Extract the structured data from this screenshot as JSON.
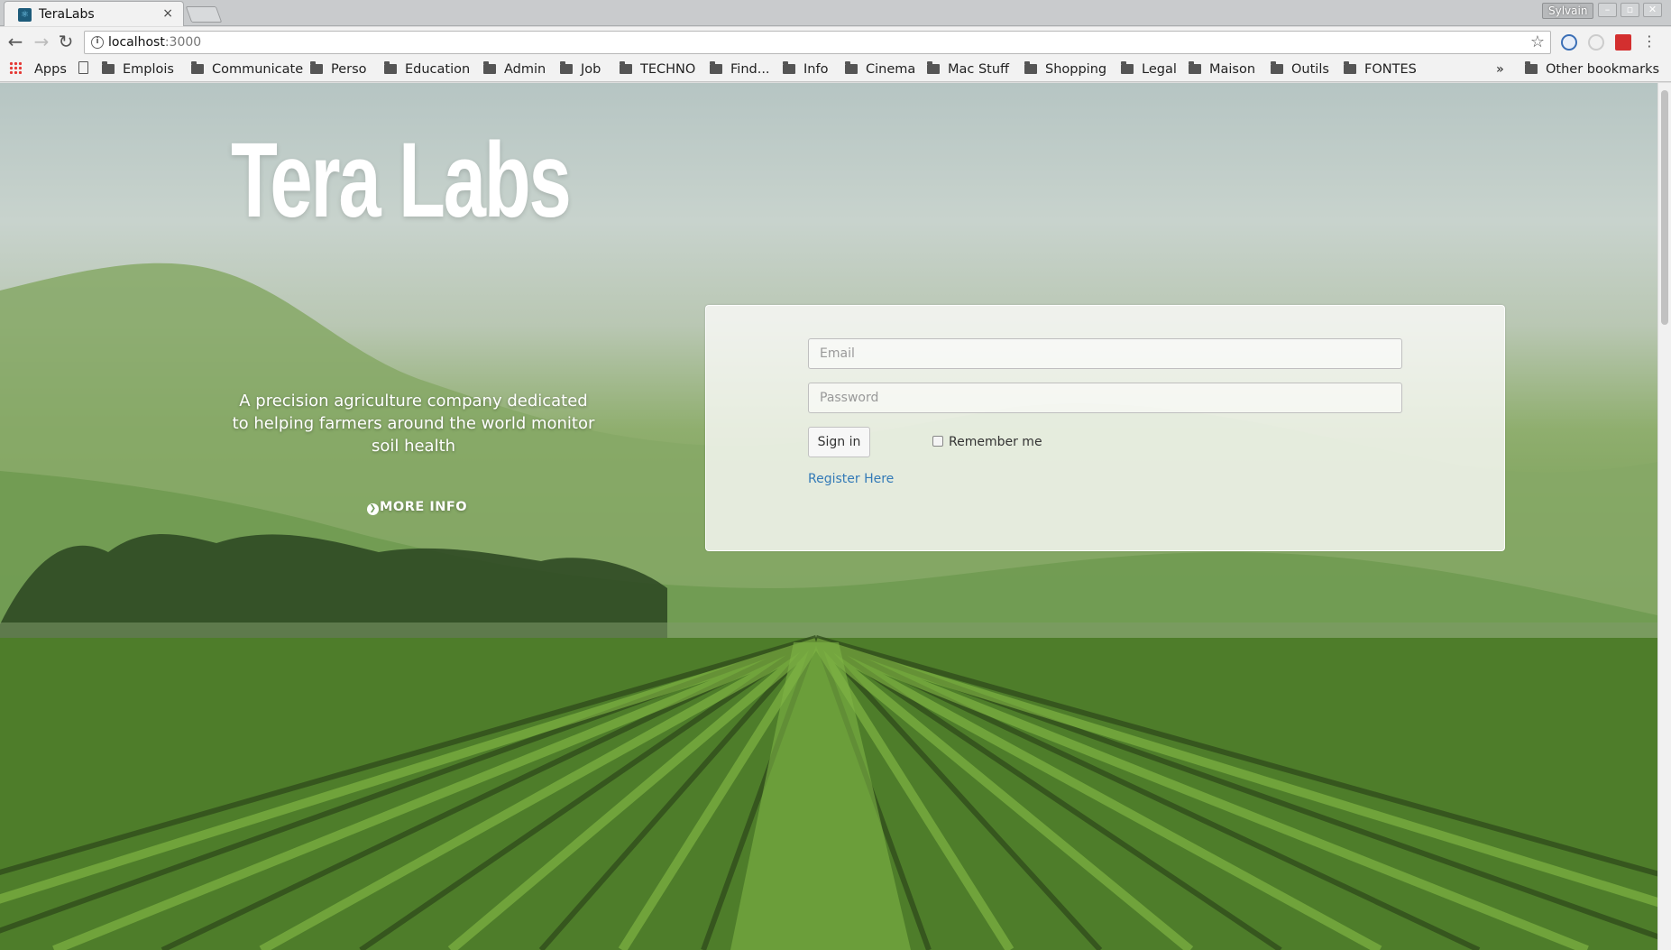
{
  "tab": {
    "title": "TeraLabs",
    "close": "×"
  },
  "profile": {
    "name": "Sylvain"
  },
  "window_controls": {
    "minimize": "–",
    "maximize": "▫",
    "close": "✕"
  },
  "nav": {
    "back": "←",
    "forward": "→",
    "reload": "↻"
  },
  "address": {
    "host": "localhost",
    "port": ":3000",
    "info_glyph": "i",
    "star_glyph": "☆"
  },
  "bookmarks": {
    "apps_label": "Apps",
    "items": [
      "Emplois",
      "Communicate",
      "Perso",
      "Education",
      "Admin",
      "Job",
      "TECHNO",
      "Find...",
      "Info",
      "Cinema",
      "Mac Stuff",
      "Shopping",
      "Legal",
      "Maison",
      "Outils",
      "FONTES"
    ],
    "overflow": "»",
    "other": "Other bookmarks"
  },
  "hero": {
    "title": "Tera Labs",
    "tagline": "A precision agriculture company dedicated to helping farmers around the world monitor soil health",
    "more_info": "MORE INFO",
    "more_info_icon": "❯"
  },
  "login": {
    "email_placeholder": "Email",
    "password_placeholder": "Password",
    "sign_in": "Sign in",
    "remember_me": "Remember me",
    "register": "Register Here"
  },
  "colors": {
    "link": "#337ab7",
    "hero_text": "#ffffff",
    "accent_ext_red": "#d32f2f"
  }
}
